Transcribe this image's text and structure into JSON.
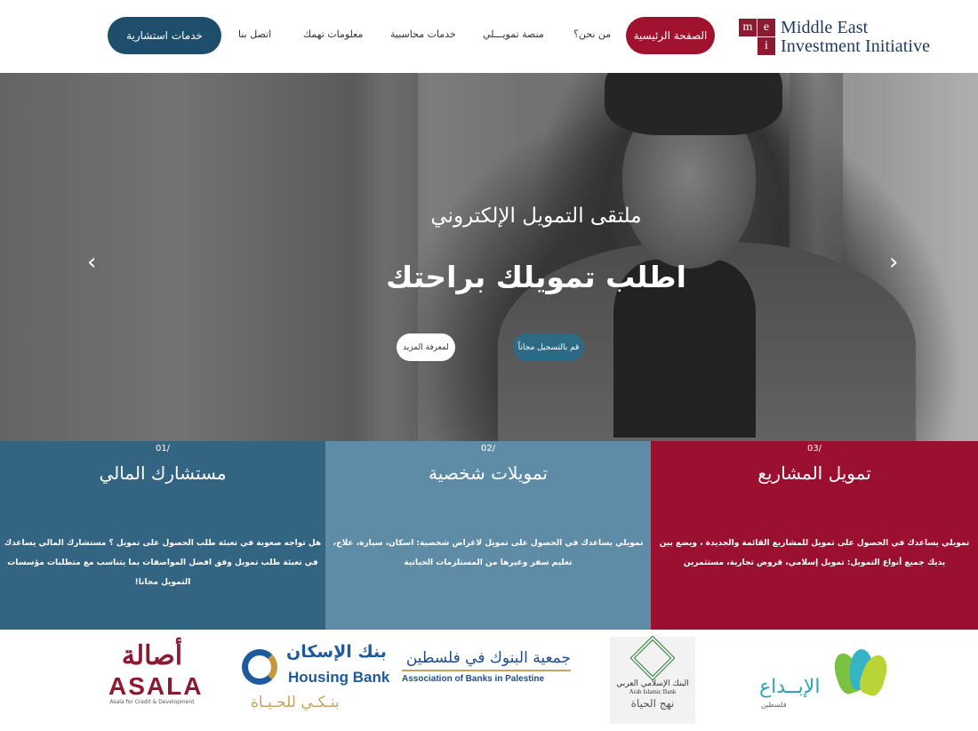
{
  "brand": {
    "logo_letters": [
      "m",
      "e",
      "",
      "i"
    ],
    "logo_line1": "Middle East",
    "logo_line2": "Investment Initiative"
  },
  "nav": {
    "home": "الصفحة الرئيسية",
    "items": [
      "من نحن؟",
      "منصة تمويـــلي",
      "خدمات محاسبية",
      "معلومات تهمك",
      "اتصل بنا"
    ],
    "cta": "خدمات استشارية"
  },
  "hero": {
    "subtitle": "ملتقى التمويل الإلكتروني",
    "title": "اطلب تمويلك براحتك",
    "btn_register": "قم بالتسجيل مجاناً",
    "btn_more": "لمعرفة المزيد",
    "prev_arrow": "‹",
    "next_arrow": "›"
  },
  "services": [
    {
      "num": "01/",
      "title": "مستشارك المالي",
      "desc": "هل تواجه صعوبة في تعبئة طلب الحصول على تمويل ؟ مستشارك المالي يساعدك في تعبئة طلب تمويل وفق افضل المواصفات بما يتناسب مع متطلبات مؤسسات التمويل مجانا!"
    },
    {
      "num": "02/",
      "title": "تمويلات شخصية",
      "desc": "تمويلي يساعدك في الحصول على تمويل لاغراض شخصية: اسكان، سيارة، علاج، تعليم سفر وغيرها من المستلزمات الحياتية"
    },
    {
      "num": "03/",
      "title": "تمويل المشاريع",
      "desc": "تمويلي يساعدك في الحصول على تمويل للمشاريع القائمة والجديدة ، ويضع بين يديك جميع أنواع التمويل: تمويل إسلامي، قروض تجارية، مستثمرين"
    }
  ],
  "partners": {
    "asala": {
      "ar": "أصالة",
      "en": "ASALA",
      "small": "Asala for Credit & Development"
    },
    "housing": {
      "ar": "بنك الإسكان",
      "en": "Housing Bank",
      "tagline": "بنـكـي للحـيـاة"
    },
    "abp": {
      "ar": "جمعية البنوك في فلسطين",
      "en": "Association of Banks in Palestine"
    },
    "aib": {
      "ar": "البنك الإسلامي العربي",
      "en": "Arab Islamic Bank",
      "tagline": "نهج الحياة"
    },
    "ibdaa": {
      "ar": "الإبــداع",
      "small": "فلسطين"
    }
  },
  "colors": {
    "brand_red": "#a0122e",
    "brand_blue": "#1f4e6d",
    "panel1": "#336482",
    "panel2": "#5e8ba6",
    "panel3": "#9b0f30"
  }
}
